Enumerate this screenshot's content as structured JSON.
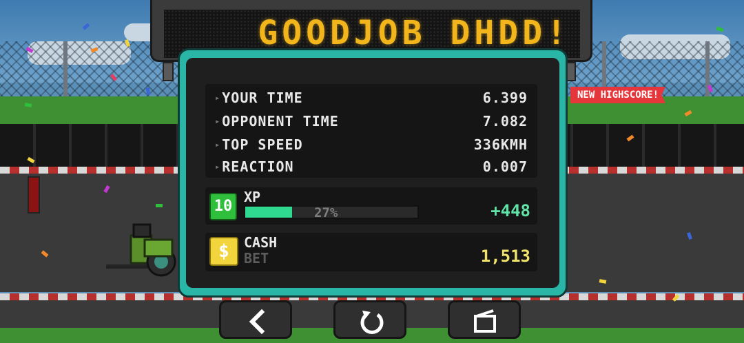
{
  "banner": {
    "text": "GOODJOB DHDD!"
  },
  "results": [
    {
      "label": "YOUR TIME",
      "value": "6.399"
    },
    {
      "label": "OPPONENT TIME",
      "value": "7.082"
    },
    {
      "label": "TOP SPEED",
      "value": "336KMH"
    },
    {
      "label": "REACTION",
      "value": "0.007"
    }
  ],
  "badge": {
    "text": "NEW HIGHSCORE!"
  },
  "xp": {
    "level": "10",
    "label": "XP",
    "percent_text": "27%",
    "progress": 0.27,
    "gain": "+448"
  },
  "cash": {
    "label": "CASH",
    "sublabel": "BET",
    "value": "1,513",
    "icon": "dollar-coin-icon"
  },
  "buttons": [
    {
      "name": "back-button",
      "icon": "chevron-left-icon"
    },
    {
      "name": "retry-button",
      "icon": "restart-icon"
    },
    {
      "name": "replay-button",
      "icon": "video-camera-icon"
    }
  ],
  "colors": {
    "sign_text": "#f2b51c",
    "panel_frame": "#2ab6a6",
    "xp_fill": "#2fd98f",
    "xp_gain": "#5fe3a6",
    "cash_value": "#f0e36a",
    "highscore_badge": "#e5363c"
  }
}
